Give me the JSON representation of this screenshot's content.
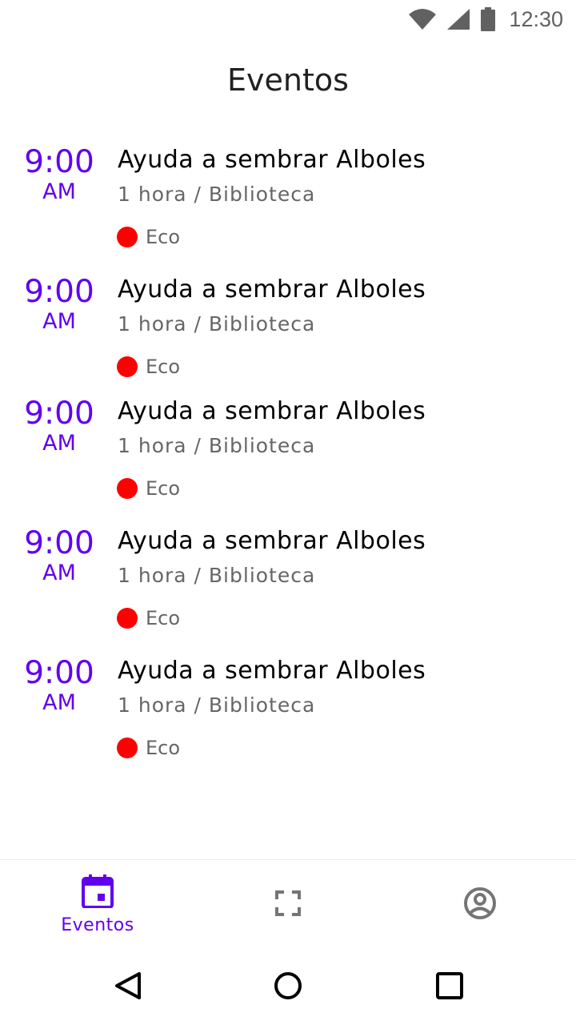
{
  "status_bar": {
    "time": "12:30",
    "icons": [
      "wifi-icon",
      "cell-signal-icon",
      "battery-icon"
    ]
  },
  "header": {
    "title": "Eventos"
  },
  "events": [
    {
      "hour": "9:00",
      "ampm": "AM",
      "title": "Ayuda a sembrar Alboles",
      "meta": "1 hora / Biblioteca",
      "tag": "Eco",
      "tag_color": "#ff0000"
    },
    {
      "hour": "9:00",
      "ampm": "AM",
      "title": "Ayuda a sembrar Alboles",
      "meta": "1 hora / Biblioteca",
      "tag": "Eco",
      "tag_color": "#ff0000"
    },
    {
      "hour": "9:00",
      "ampm": "AM",
      "title": "Ayuda a sembrar Alboles",
      "meta": "1 hora / Biblioteca",
      "tag": "Eco",
      "tag_color": "#ff0000"
    },
    {
      "hour": "9:00",
      "ampm": "AM",
      "title": "Ayuda a sembrar Alboles",
      "meta": "1 hora / Biblioteca",
      "tag": "Eco",
      "tag_color": "#ff0000"
    },
    {
      "hour": "9:00",
      "ampm": "AM",
      "title": "Ayuda a sembrar Alboles",
      "meta": "1 hora / Biblioteca",
      "tag": "Eco",
      "tag_color": "#ff0000"
    }
  ],
  "bottom_nav": {
    "items": [
      {
        "label": "Eventos",
        "icon": "calendar-icon",
        "active": true
      },
      {
        "label": "",
        "icon": "scan-icon",
        "active": false
      },
      {
        "label": "",
        "icon": "account-icon",
        "active": false
      }
    ],
    "active_color": "#6200ee",
    "inactive_color": "#757575"
  },
  "colors": {
    "accent": "#6200ee",
    "tag_red": "#ff0000"
  }
}
